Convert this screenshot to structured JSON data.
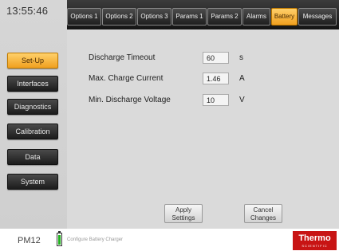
{
  "clock": "13:55:46",
  "tabs": [
    "Options 1",
    "Options 2",
    "Options 3",
    "Params 1",
    "Params 2",
    "Alarms",
    "Battery",
    "Messages"
  ],
  "active_tab": "Battery",
  "sidebar": {
    "items": [
      "Set-Up",
      "Interfaces",
      "Diagnostics",
      "Calibration",
      "Data",
      "System"
    ],
    "active": "Set-Up"
  },
  "battery": {
    "rows": [
      {
        "label": "Discharge Timeout",
        "value": "60",
        "unit": "s"
      },
      {
        "label": "Max. Charge Current",
        "value": "1.46",
        "unit": "A"
      },
      {
        "label": "Min. Discharge Voltage",
        "value": "10",
        "unit": "V"
      }
    ]
  },
  "actions": {
    "apply_line1": "Apply",
    "apply_line2": "Settings",
    "cancel_line1": "Cancel",
    "cancel_line2": "Changes"
  },
  "status": {
    "device": "PM12",
    "message": "Configure Battery Charger",
    "battery_level": 1.0
  },
  "logo": {
    "main": "Thermo",
    "sub": "SCIENTIFIC"
  },
  "colors": {
    "accent": "#f0a020",
    "logo": "#c81414",
    "battery": "#21b21e"
  }
}
